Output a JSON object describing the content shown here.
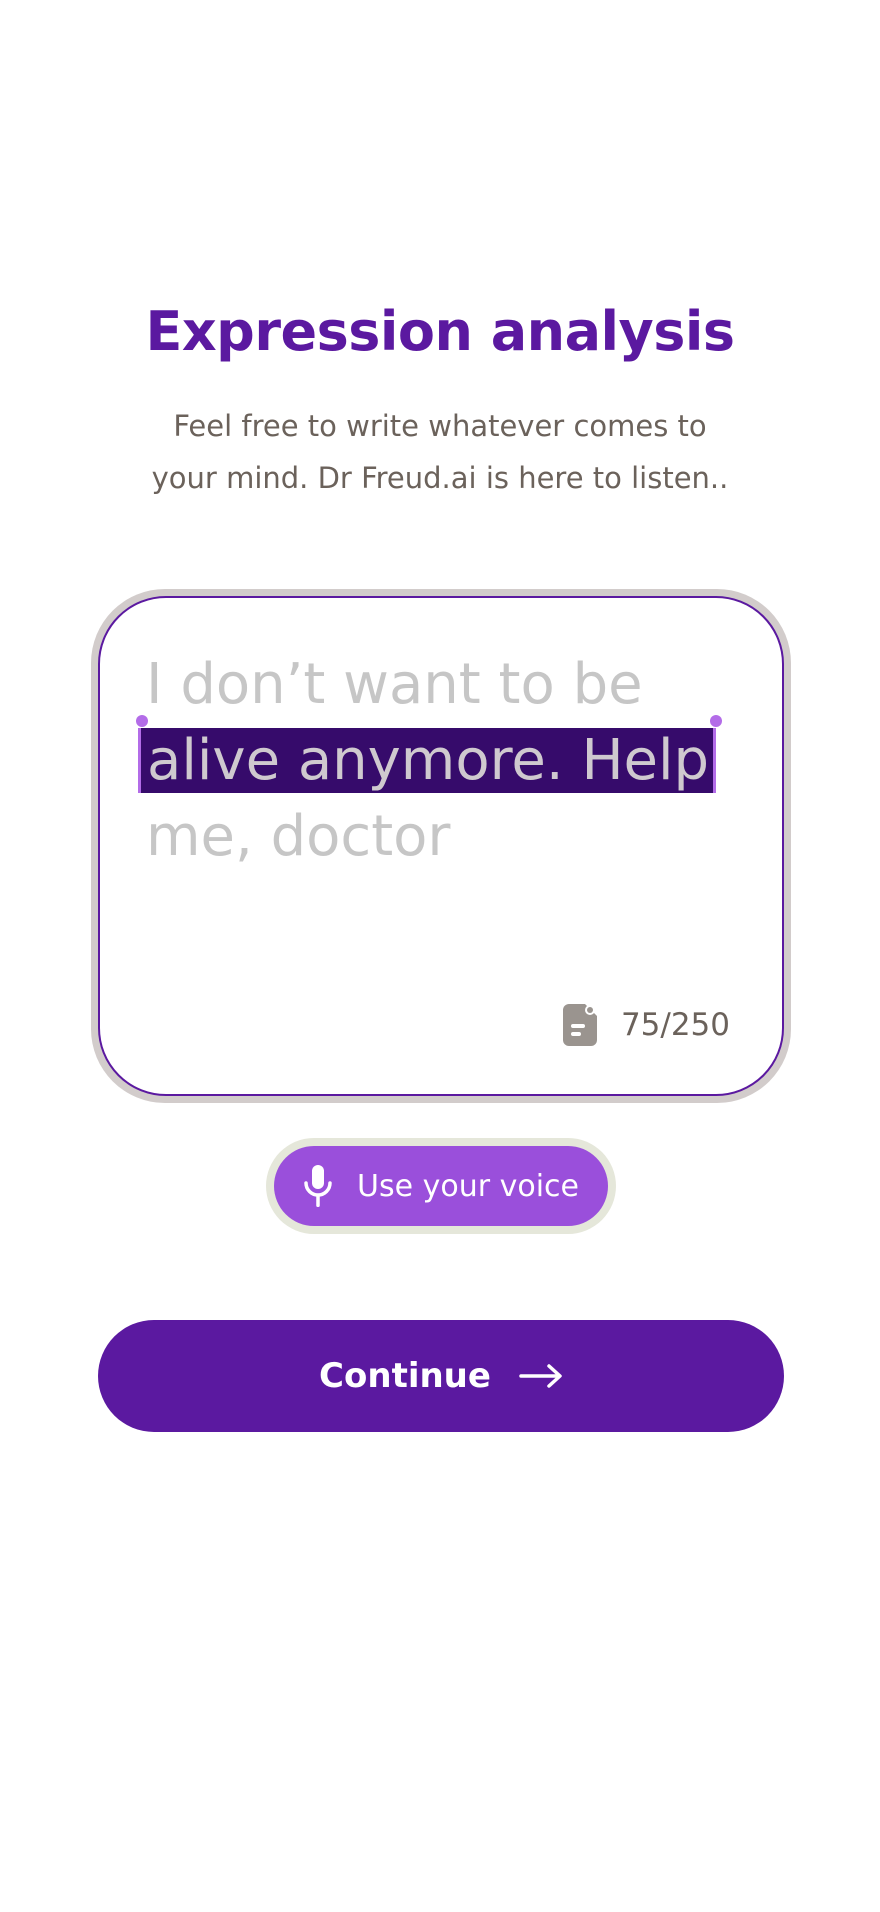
{
  "header": {
    "title": "Expression analysis",
    "subtitle": "Feel free to write whatever comes to your mind. Dr Freud.ai is here to listen.."
  },
  "entry": {
    "line1": "I don’t want to be",
    "line2_selected": "alive anymore. Help",
    "line3": "me, doctor",
    "char_count": "75/250",
    "char_count_icon": "document-icon"
  },
  "voice_button": {
    "label": "Use your voice",
    "icon": "microphone-icon"
  },
  "continue_button": {
    "label": "Continue",
    "icon": "arrow-right-icon"
  },
  "colors": {
    "primary": "#5b19a0",
    "accent": "#9a4fdb",
    "selection": "#360b6b",
    "text_muted": "#6b625b"
  }
}
